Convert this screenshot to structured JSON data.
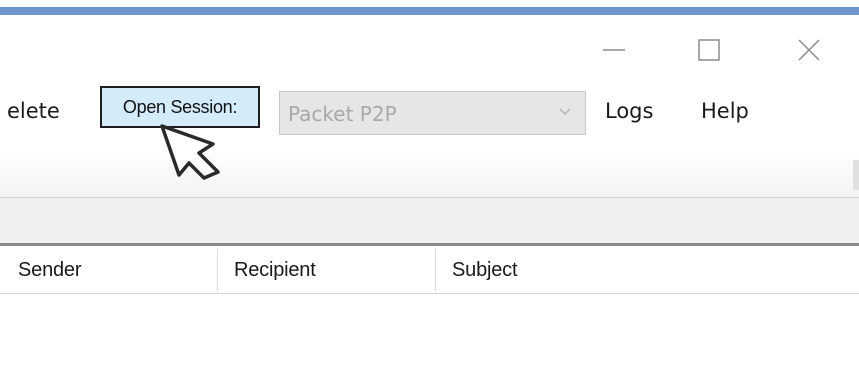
{
  "window": {
    "minimize_icon": "minimize-icon",
    "maximize_icon": "maximize-icon",
    "close_icon": "close-icon",
    "border_color": "#6f93cc"
  },
  "menu": {
    "delete_label": "elete",
    "logs_label": "Logs",
    "help_label": "Help"
  },
  "session": {
    "label": "Open Session:",
    "selected_value": "Packet P2P",
    "label_background": "#d4ebfa"
  },
  "message_list": {
    "columns": [
      "Sender",
      "Recipient",
      "Subject"
    ]
  },
  "cursor": {
    "icon": "mouse-pointer-icon"
  }
}
